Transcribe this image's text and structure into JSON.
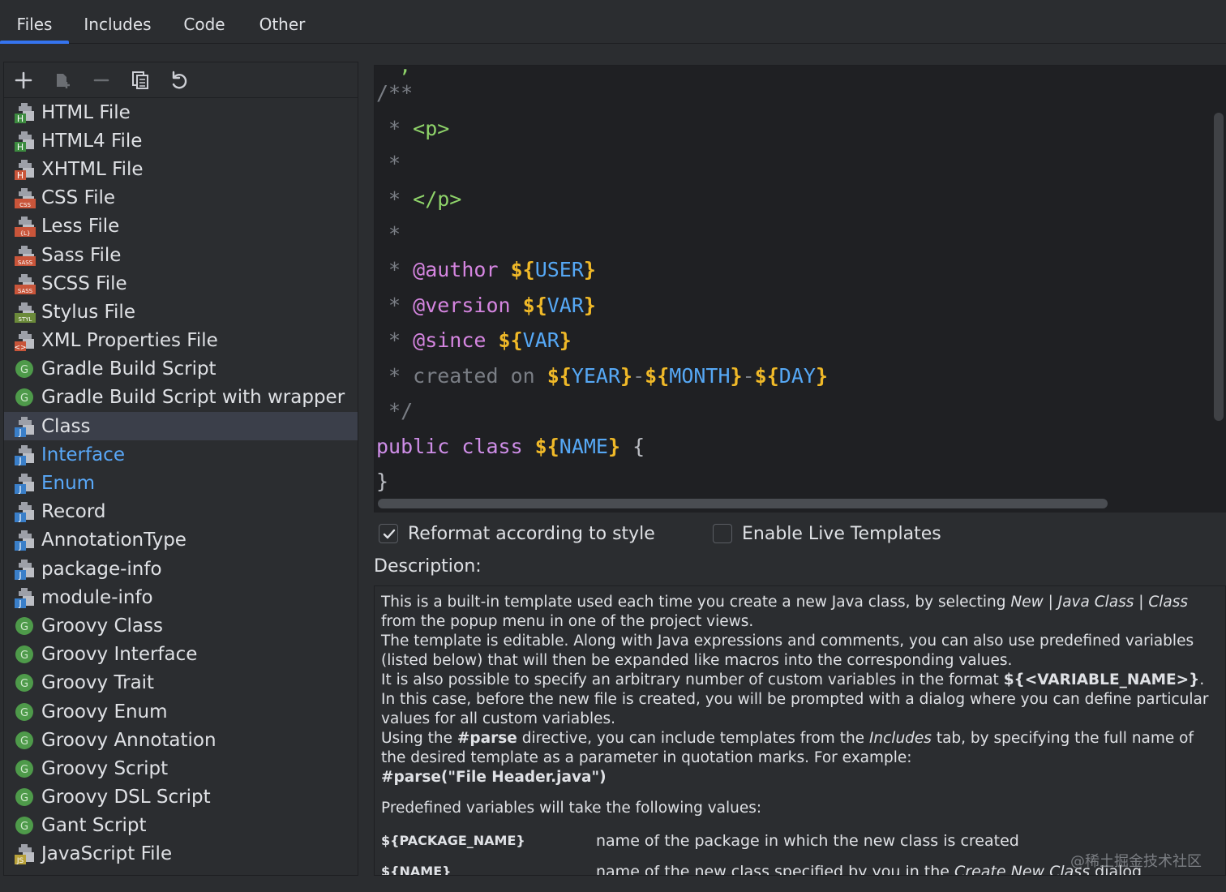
{
  "tabs": [
    {
      "label": "Files",
      "active": true
    },
    {
      "label": "Includes",
      "active": false
    },
    {
      "label": "Code",
      "active": false
    },
    {
      "label": "Other",
      "active": false
    }
  ],
  "toolbar": {
    "icons": [
      "add-icon",
      "copy-template-icon",
      "remove-icon",
      "duplicate-icon",
      "reset-icon"
    ]
  },
  "file_list": [
    {
      "label": "HTML File",
      "icon": "html-file-icon",
      "badge": "H",
      "badge_color": "#3d8c40"
    },
    {
      "label": "HTML4 File",
      "icon": "html4-file-icon",
      "badge": "H",
      "badge_color": "#3d8c40"
    },
    {
      "label": "XHTML File",
      "icon": "xhtml-file-icon",
      "badge": "H",
      "badge_color": "#c9553a"
    },
    {
      "label": "CSS File",
      "icon": "css-file-icon",
      "badge": "CSS",
      "badge_color": "#c9553a"
    },
    {
      "label": "Less File",
      "icon": "less-file-icon",
      "badge": "{L}",
      "badge_color": "#c9553a"
    },
    {
      "label": "Sass File",
      "icon": "sass-file-icon",
      "badge": "SASS",
      "badge_color": "#c9553a"
    },
    {
      "label": "SCSS File",
      "icon": "scss-file-icon",
      "badge": "SASS",
      "badge_color": "#c9553a"
    },
    {
      "label": "Stylus File",
      "icon": "stylus-file-icon",
      "badge": "STYL",
      "badge_color": "#6b8a3a"
    },
    {
      "label": "XML Properties File",
      "icon": "xml-file-icon",
      "badge": "<>",
      "badge_color": "#c9553a"
    },
    {
      "label": "Gradle Build Script",
      "icon": "gradle-icon",
      "circle": true
    },
    {
      "label": "Gradle Build Script with wrapper",
      "icon": "gradle-icon",
      "circle": true
    },
    {
      "label": "Class",
      "icon": "java-class-icon",
      "badge": "J",
      "badge_color": "#3a7fc9",
      "selected": true
    },
    {
      "label": "Interface",
      "icon": "java-interface-icon",
      "badge": "J",
      "badge_color": "#3a7fc9",
      "blue": true
    },
    {
      "label": "Enum",
      "icon": "java-enum-icon",
      "badge": "J",
      "badge_color": "#3a7fc9",
      "blue": true
    },
    {
      "label": "Record",
      "icon": "java-record-icon",
      "badge": "J",
      "badge_color": "#3a7fc9"
    },
    {
      "label": "AnnotationType",
      "icon": "java-annotation-icon",
      "badge": "J",
      "badge_color": "#3a7fc9"
    },
    {
      "label": "package-info",
      "icon": "java-package-icon",
      "badge": "J",
      "badge_color": "#3a7fc9"
    },
    {
      "label": "module-info",
      "icon": "java-module-icon",
      "badge": "J",
      "badge_color": "#3a7fc9"
    },
    {
      "label": "Groovy Class",
      "icon": "groovy-icon",
      "circle": true
    },
    {
      "label": "Groovy Interface",
      "icon": "groovy-icon",
      "circle": true
    },
    {
      "label": "Groovy Trait",
      "icon": "groovy-icon",
      "circle": true
    },
    {
      "label": "Groovy Enum",
      "icon": "groovy-icon",
      "circle": true
    },
    {
      "label": "Groovy Annotation",
      "icon": "groovy-icon",
      "circle": true
    },
    {
      "label": "Groovy Script",
      "icon": "groovy-icon",
      "circle": true
    },
    {
      "label": "Groovy DSL Script",
      "icon": "groovy-icon",
      "circle": true
    },
    {
      "label": "Gant Script",
      "icon": "groovy-icon",
      "circle": true
    },
    {
      "label": "JavaScript File",
      "icon": "javascript-file-icon",
      "badge": "JS",
      "badge_color": "#b8a13a"
    }
  ],
  "editor": {
    "lines": [
      [
        [
          "c-com",
          "/**"
        ]
      ],
      [
        [
          "c-com",
          " * "
        ],
        [
          "c-tag",
          "<p>"
        ]
      ],
      [
        [
          "c-com",
          " *"
        ]
      ],
      [
        [
          "c-com",
          " * "
        ],
        [
          "c-tag",
          "</p>"
        ]
      ],
      [
        [
          "c-com",
          " *"
        ]
      ],
      [
        [
          "c-com",
          " * "
        ],
        [
          "c-ann",
          "@author"
        ],
        [
          "c-plain",
          " "
        ],
        [
          "c-brace",
          "${"
        ],
        [
          "c-var",
          "USER"
        ],
        [
          "c-brace",
          "}"
        ]
      ],
      [
        [
          "c-com",
          " * "
        ],
        [
          "c-ann",
          "@version"
        ],
        [
          "c-plain",
          " "
        ],
        [
          "c-brace",
          "${"
        ],
        [
          "c-var",
          "VAR"
        ],
        [
          "c-brace",
          "}"
        ]
      ],
      [
        [
          "c-com",
          " * "
        ],
        [
          "c-ann",
          "@since"
        ],
        [
          "c-plain",
          " "
        ],
        [
          "c-brace",
          "${"
        ],
        [
          "c-var",
          "VAR"
        ],
        [
          "c-brace",
          "}"
        ]
      ],
      [
        [
          "c-com",
          " * created on "
        ],
        [
          "c-brace",
          "${"
        ],
        [
          "c-var",
          "YEAR"
        ],
        [
          "c-brace",
          "}"
        ],
        [
          "c-com",
          "-"
        ],
        [
          "c-brace",
          "${"
        ],
        [
          "c-var",
          "MONTH"
        ],
        [
          "c-brace",
          "}"
        ],
        [
          "c-com",
          "-"
        ],
        [
          "c-brace",
          "${"
        ],
        [
          "c-var",
          "DAY"
        ],
        [
          "c-brace",
          "}"
        ]
      ],
      [
        [
          "c-com",
          " */"
        ]
      ],
      [
        [
          "c-kw",
          "public class "
        ],
        [
          "c-brace",
          "${"
        ],
        [
          "c-var",
          "NAME"
        ],
        [
          "c-brace",
          "}"
        ],
        [
          "c-plain",
          " {"
        ]
      ],
      [
        [
          "c-plain",
          "}"
        ]
      ]
    ]
  },
  "options": {
    "reformat_label": "Reformat according to style",
    "reformat_checked": true,
    "live_templates_label": "Enable Live Templates",
    "live_templates_checked": false
  },
  "description": {
    "label": "Description:",
    "p1_a": "This is a built-in template used each time you create a new Java class, by selecting ",
    "p1_i": "New | Java Class | Class",
    "p1_b": " from the popup menu in one of the project views.",
    "p2": "The template is editable. Along with Java expressions and comments, you can also use predefined variables (listed below) that will then be expanded like macros into the corresponding values.",
    "p3_a": "It is also possible to specify an arbitrary number of custom variables in the format ",
    "p3_b": "${<VARIABLE_NAME>}",
    "p3_c": ". In this case, before the new file is created, you will be prompted with a dialog where you can define particular values for all custom variables.",
    "p4_a": "Using the ",
    "p4_b": "#parse",
    "p4_c": " directive, you can include templates from the ",
    "p4_i": "Includes",
    "p4_d": " tab, by specifying the full name of the desired template as a parameter in quotation marks. For example:",
    "p5": "#parse(\"File Header.java\")",
    "p6": "Predefined variables will take the following values:",
    "vars": [
      {
        "name": "${PACKAGE_NAME}",
        "desc": "name of the package in which the new class is created"
      },
      {
        "name": "${NAME}",
        "desc_a": "name of the new class specified by you in the ",
        "desc_i": "Create New Class",
        "desc_b": " dialog"
      }
    ]
  },
  "watermark": "@稀土掘金技术社区",
  "colors": {
    "accent": "#3574f0",
    "background": "#2b2d30",
    "editor_bg": "#1f2023"
  }
}
